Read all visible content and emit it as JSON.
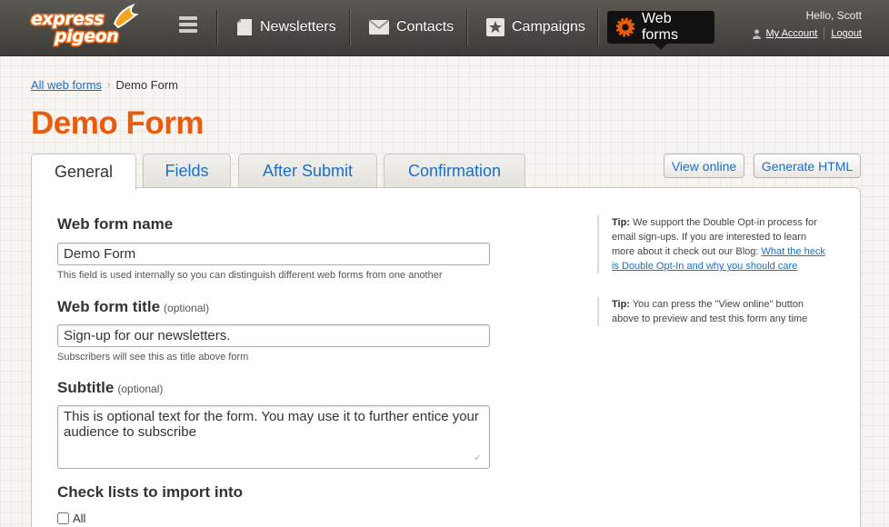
{
  "brand": {
    "logo_line1": "express",
    "logo_line2": "pigeon",
    "accent": "#ea5b0c",
    "link_color": "#1a6fc9"
  },
  "nav": {
    "menu_icon": "hamburger-icon",
    "items": [
      {
        "label": "Newsletters",
        "icon": "document-icon"
      },
      {
        "label": "Contacts",
        "icon": "envelope-icon"
      },
      {
        "label": "Campaigns",
        "icon": "star-icon"
      },
      {
        "label": "Web forms",
        "icon": "gear-icon",
        "active": true
      }
    ]
  },
  "account": {
    "greeting": "Hello, Scott",
    "my_account": "My Account",
    "logout": "Logout"
  },
  "breadcrumb": {
    "parent": "All web forms",
    "current": "Demo Form"
  },
  "page_title": "Demo Form",
  "tabs": [
    {
      "label": "General",
      "active": true
    },
    {
      "label": "Fields"
    },
    {
      "label": "After Submit"
    },
    {
      "label": "Confirmation"
    }
  ],
  "actions": {
    "view_online": "View online",
    "generate_html": "Generate HTML"
  },
  "form": {
    "name": {
      "label": "Web form name",
      "value": "Demo Form",
      "help": "This field is used internally so you can distinguish different web forms from one another"
    },
    "title": {
      "label": "Web form title",
      "optional": "(optional)",
      "value": "Sign-up for our newsletters.",
      "help": "Subscribers will see this as title above form"
    },
    "subtitle": {
      "label": "Subtitle",
      "optional": "(optional)",
      "value": "This is optional text for the form. You may use it to further entice your audience to subscribe"
    },
    "lists": {
      "label": "Check lists to import into",
      "all_label": "All"
    }
  },
  "tips": [
    {
      "prefix": "Tip:",
      "text": "We support the Double Opt-in process for email sign-ups. If you are interested to learn more about it check out our Blog:",
      "link": "What the heck is Double Opt-In and why you should care"
    },
    {
      "prefix": "Tip:",
      "text": "You can press the \"View online\" button above to preview and test this form any time"
    }
  ]
}
